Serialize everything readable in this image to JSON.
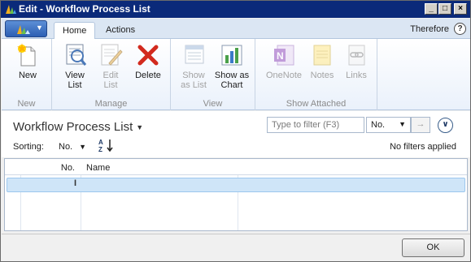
{
  "window": {
    "title": "Edit - Workflow Process List"
  },
  "tabs": [
    {
      "label": "Home"
    },
    {
      "label": "Actions"
    }
  ],
  "company": "Therefore",
  "ribbon": {
    "groups": [
      {
        "label": "New",
        "buttons": [
          {
            "label": "New"
          }
        ]
      },
      {
        "label": "Manage",
        "buttons": [
          {
            "label": "View\nList"
          },
          {
            "label": "Edit\nList"
          },
          {
            "label": "Delete"
          }
        ]
      },
      {
        "label": "View",
        "buttons": [
          {
            "label": "Show\nas List"
          },
          {
            "label": "Show as\nChart"
          }
        ]
      },
      {
        "label": "Show Attached",
        "buttons": [
          {
            "label": "OneNote"
          },
          {
            "label": "Notes"
          },
          {
            "label": "Links"
          }
        ]
      }
    ]
  },
  "list": {
    "title": "Workflow Process List",
    "filter_placeholder": "Type to filter (F3)",
    "filter_field": "No.",
    "sorting_label": "Sorting:",
    "sorting_value": "No.",
    "no_filters": "No filters applied",
    "columns": [
      "No.",
      "Name"
    ]
  },
  "footer": {
    "ok_label": "OK"
  },
  "colors": {
    "titlebar": "#0b2a7a",
    "selected_row": "#cfe5f8"
  }
}
